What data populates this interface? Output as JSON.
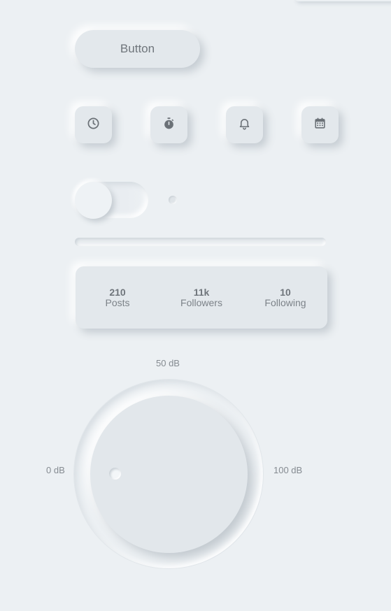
{
  "button": {
    "label": "Button"
  },
  "icon_buttons": [
    {
      "icon": "clock-icon"
    },
    {
      "icon": "stopwatch-icon"
    },
    {
      "icon": "bell-icon"
    },
    {
      "icon": "calendar-icon"
    }
  ],
  "toggle": {
    "state": "off"
  },
  "radio": {
    "selected": false
  },
  "stats": [
    {
      "value": "210",
      "label": "Posts"
    },
    {
      "value": "11k",
      "label": "Followers"
    },
    {
      "value": "10",
      "label": "Following"
    }
  ],
  "volume_knob": {
    "min_label": "0 dB",
    "mid_label": "50 dB",
    "max_label": "100 dB",
    "value_db": 0
  },
  "colors": {
    "background": "#ecf0f3",
    "surface": "#e3e8ec",
    "icon": "#6b7177",
    "text": "#7a8087"
  }
}
